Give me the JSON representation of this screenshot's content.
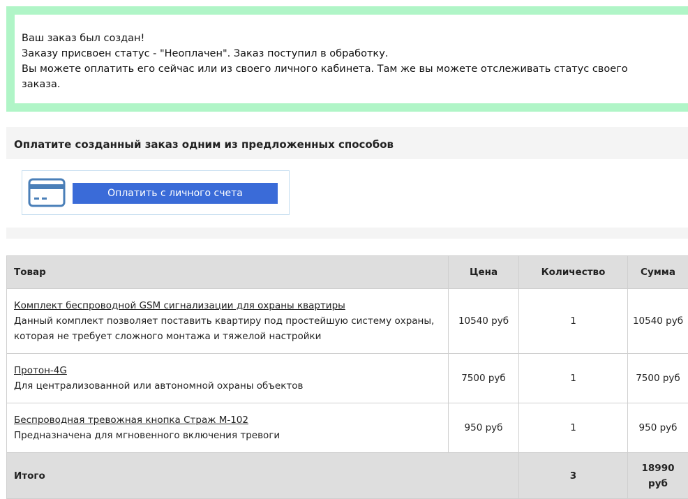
{
  "notice": {
    "lines": [
      "Ваш заказ был создан!",
      "Заказу присвоен статус - \"Неоплачен\". Заказ поступил в обработку.",
      "Вы можете оплатить его сейчас или из своего личного кабинета. Там же вы можете отслеживать статус своего",
      "заказа."
    ],
    "border_color": "#b0f5c7"
  },
  "payment": {
    "title": "Оплатите созданный заказ одним из предложенных способов",
    "button_label": "Оплатить с личного счета",
    "icon": "credit-card-icon",
    "button_color": "#3a6bd8"
  },
  "table": {
    "headers": {
      "product": "Товар",
      "price": "Цена",
      "quantity": "Количество",
      "sum": "Сумма"
    },
    "rows": [
      {
        "name": "Комплект беспроводной GSM сигнализации для охраны квартиры",
        "description": "Данный комплект позволяет поставить квартиру под простейшую систему охраны, которая не требует сложного монтажа и тяжелой настройки",
        "price": "10540 руб",
        "quantity": "1",
        "sum": "10540 руб"
      },
      {
        "name": "Протон-4G",
        "description": "Для централизованной или автономной охраны объектов",
        "price": "7500 руб",
        "quantity": "1",
        "sum": "7500 руб"
      },
      {
        "name": "Беспроводная тревожная кнопка Страж М-102",
        "description": "Предназначена для мгновенного включения тревоги",
        "price": "950 руб",
        "quantity": "1",
        "sum": "950 руб"
      }
    ],
    "footer": {
      "label": "Итого",
      "quantity": "3",
      "sum_value": "18990",
      "sum_unit": "руб"
    }
  }
}
